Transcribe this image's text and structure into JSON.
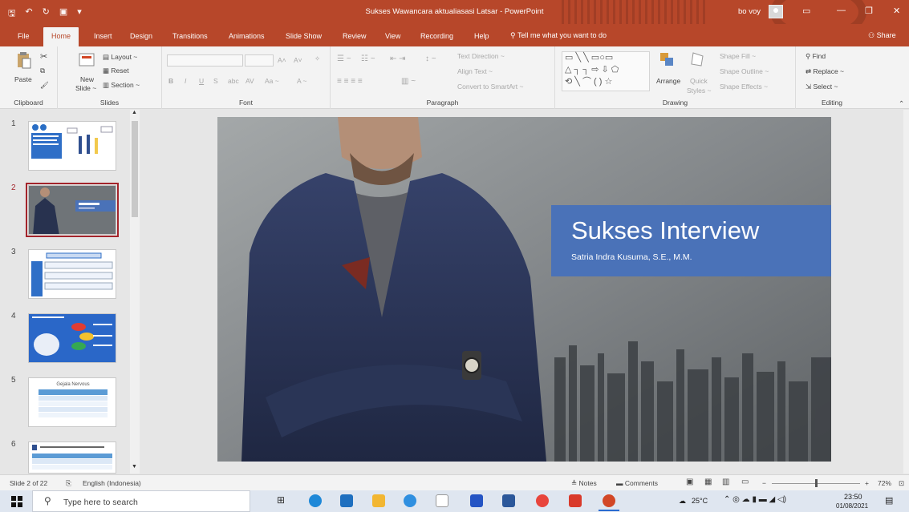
{
  "window": {
    "title": "Sukses Wawancara aktualiasasi Latsar  -  PowerPoint",
    "user": "bo voy"
  },
  "tabs": [
    "File",
    "Home",
    "Insert",
    "Design",
    "Transitions",
    "Animations",
    "Slide Show",
    "Review",
    "View",
    "Recording",
    "Help"
  ],
  "tell_me": "Tell me what you want to do",
  "share": "Share",
  "ribbon": {
    "clipboard": {
      "label": "Clipboard",
      "paste": "Paste"
    },
    "slides": {
      "label": "Slides",
      "new_slide": "New",
      "new_slide2": "Slide ~",
      "layout": "Layout ~",
      "reset": "Reset",
      "section": "Section ~"
    },
    "font": {
      "label": "Font"
    },
    "paragraph": {
      "label": "Paragraph",
      "text_direction": "Text Direction ~",
      "align_text": "Align Text ~",
      "convert": "Convert to SmartArt ~"
    },
    "drawing": {
      "label": "Drawing",
      "arrange": "Arrange",
      "quick_styles": "Quick",
      "quick_styles2": "Styles ~",
      "shape_fill": "Shape Fill ~",
      "shape_outline": "Shape Outline ~",
      "shape_effects": "Shape Effects ~"
    },
    "editing": {
      "label": "Editing",
      "find": "Find",
      "replace": "Replace ~",
      "select": "Select ~"
    }
  },
  "thumbnails": [
    {
      "num": "1"
    },
    {
      "num": "2"
    },
    {
      "num": "3"
    },
    {
      "num": "4"
    },
    {
      "num": "5",
      "title": "Gejala Nervous"
    },
    {
      "num": "6"
    }
  ],
  "slide": {
    "title": "Sukses Interview",
    "subtitle": "Satria Indra Kusuma, S.E., M.M."
  },
  "status": {
    "slide_of": "Slide 2 of 22",
    "language": "English (Indonesia)",
    "notes": "Notes",
    "comments": "Comments",
    "zoom": "72%"
  },
  "taskbar": {
    "search_placeholder": "Type here to search",
    "temp": "25°C",
    "time": "23:50",
    "date": "01/08/2021"
  },
  "colors": {
    "accent": "#b7472a",
    "title_box": "#4a72b8"
  }
}
